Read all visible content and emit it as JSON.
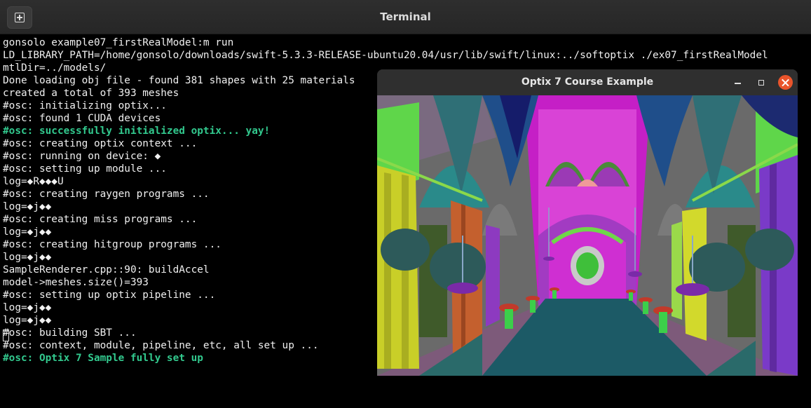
{
  "terminal": {
    "title": "Terminal",
    "lines": [
      {
        "text": "gonsolo example07_firstRealModel:m run",
        "green": false
      },
      {
        "text": "LD_LIBRARY_PATH=/home/gonsolo/downloads/swift-5.3.3-RELEASE-ubuntu20.04/usr/lib/swift/linux:../softoptix ./ex07_firstRealModel",
        "green": false
      },
      {
        "text": "mtlDir=../models/",
        "green": false
      },
      {
        "text": "Done loading obj file - found 381 shapes with 25 materials",
        "green": false
      },
      {
        "text": "created a total of 393 meshes",
        "green": false
      },
      {
        "text": "#osc: initializing optix...",
        "green": false
      },
      {
        "text": "#osc: found 1 CUDA devices",
        "green": false
      },
      {
        "text": "#osc: successfully initialized optix... yay!",
        "green": true
      },
      {
        "text": "#osc: creating optix context ...",
        "green": false
      },
      {
        "text": "#osc: running on device: ◆",
        "green": false
      },
      {
        "text": "#osc: setting up module ...",
        "green": false
      },
      {
        "text": "log=◆R◆◆◆U",
        "green": false
      },
      {
        "text": "#osc: creating raygen programs ...",
        "green": false
      },
      {
        "text": "log=◆j◆◆",
        "green": false
      },
      {
        "text": "#osc: creating miss programs ...",
        "green": false
      },
      {
        "text": "log=◆j◆◆",
        "green": false
      },
      {
        "text": "#osc: creating hitgroup programs ...",
        "green": false
      },
      {
        "text": "log=◆j◆◆",
        "green": false
      },
      {
        "text": "SampleRenderer.cpp::90: buildAccel",
        "green": false
      },
      {
        "text": "model->meshes.size()=393",
        "green": false
      },
      {
        "text": "#osc: setting up optix pipeline ...",
        "green": false
      },
      {
        "text": "log=◆j◆◆",
        "green": false
      },
      {
        "text": "log=◆j◆◆",
        "green": false
      },
      {
        "text": "#osc: building SBT ...",
        "green": false
      },
      {
        "text": "#osc: context, module, pipeline, etc, all set up ...",
        "green": false
      },
      {
        "text": "#osc: Optix 7 Sample fully set up",
        "green": true
      }
    ]
  },
  "render_window": {
    "title": "Optix 7 Course Example"
  },
  "colors": {
    "terminal_bg": "#000000",
    "terminal_text": "#f0f0f0",
    "success_green": "#32c98e",
    "close_button": "#e9542b"
  }
}
